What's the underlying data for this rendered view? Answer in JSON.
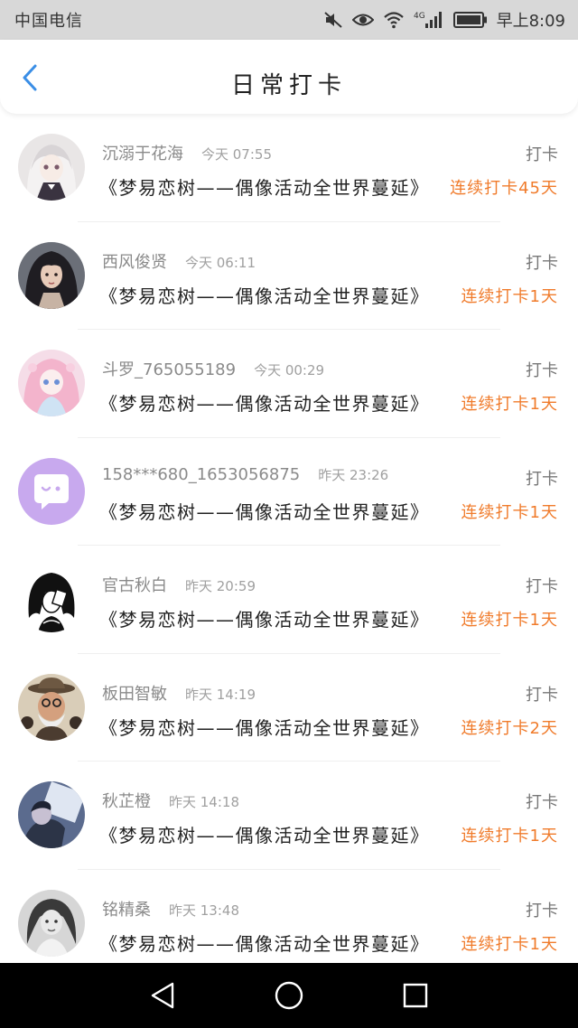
{
  "status_bar": {
    "carrier": "中国电信",
    "time": "早上8:09",
    "network": "4G"
  },
  "header": {
    "title": "日常打卡"
  },
  "theme": {
    "accent": "#3a8ee6",
    "streak_color": "#f07b2b"
  },
  "items": [
    {
      "name": "沉溺于花海",
      "time": "今天 07:55",
      "label": "打卡",
      "activity": "《梦易恋树——偶像活动全世界蔓延》",
      "streak": "连续打卡45天",
      "avatar": "anime-girl-white-hair-avatar"
    },
    {
      "name": "西风俊贤",
      "time": "今天 06:11",
      "label": "打卡",
      "activity": "《梦易恋树——偶像活动全世界蔓延》",
      "streak": "连续打卡1天",
      "avatar": "dark-hair-portrait-avatar"
    },
    {
      "name": "斗罗_765055189",
      "time": "今天 00:29",
      "label": "打卡",
      "activity": "《梦易恋树——偶像活动全世界蔓延》",
      "streak": "连续打卡1天",
      "avatar": "pink-anime-girl-avatar"
    },
    {
      "name": "158***680_1653056875",
      "time": "昨天 23:26",
      "label": "打卡",
      "activity": "《梦易恋树——偶像活动全世界蔓延》",
      "streak": "连续打卡1天",
      "avatar": "default-chat-bubble-avatar"
    },
    {
      "name": "官古秋白",
      "time": "昨天 20:59",
      "label": "打卡",
      "activity": "《梦易恋树——偶像活动全世界蔓延》",
      "streak": "连续打卡1天",
      "avatar": "black-silhouette-girl-avatar"
    },
    {
      "name": "板田智敏",
      "time": "昨天 14:19",
      "label": "打卡",
      "activity": "《梦易恋树——偶像活动全世界蔓延》",
      "streak": "连续打卡2天",
      "avatar": "old-man-hat-avatar"
    },
    {
      "name": "秋芷橙",
      "time": "昨天 14:18",
      "label": "打卡",
      "activity": "《梦易恋树——偶像活动全世界蔓延》",
      "streak": "连续打卡1天",
      "avatar": "blue-toned-photo-avatar"
    },
    {
      "name": "铭精桑",
      "time": "昨天 13:48",
      "label": "打卡",
      "activity": "《梦易恋树——偶像活动全世界蔓延》",
      "streak": "连续打卡1天",
      "avatar": "grayscale-girl-avatar"
    }
  ]
}
